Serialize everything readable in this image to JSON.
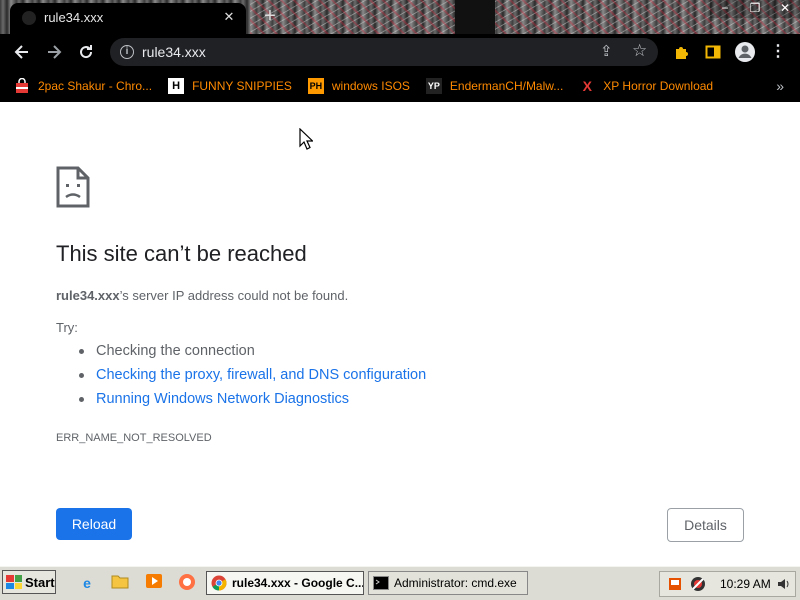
{
  "browser": {
    "tab": {
      "title": "rule34.xxx"
    },
    "address": {
      "url": "rule34.xxx"
    },
    "window_controls": {
      "minimize": "−",
      "restore": "❐",
      "close": "✕"
    }
  },
  "bookmarks": [
    {
      "label": "2pac Shakur - Chro...",
      "icon": "bag-icon"
    },
    {
      "label": "FUNNY SNIPPIES",
      "icon": "H"
    },
    {
      "label": "windows ISOS",
      "icon": "PH"
    },
    {
      "label": "EndermanCH/Malw...",
      "icon": "YP"
    },
    {
      "label": "XP Horror Download",
      "icon": "X"
    }
  ],
  "error": {
    "headline": "This site can’t be reached",
    "host": "rule34.xxx",
    "description_suffix": "’s server IP address could not be found.",
    "try_label": "Try:",
    "suggestions": {
      "s0": "Checking the connection",
      "s1": "Checking the proxy, firewall, and DNS configuration",
      "s2": "Running Windows Network Diagnostics"
    },
    "code": "ERR_NAME_NOT_RESOLVED",
    "reload_label": "Reload",
    "details_label": "Details"
  },
  "taskbar": {
    "start_label": "Start",
    "windows": [
      {
        "label": "rule34.xxx - Google C...",
        "active": true
      },
      {
        "label": "Administrator: cmd.exe",
        "active": false
      }
    ],
    "clock": "10:29 AM"
  },
  "colors": {
    "accent": "#1a73e8",
    "bookmark_text": "#ff8a00",
    "chrome_dark": "#000000"
  }
}
